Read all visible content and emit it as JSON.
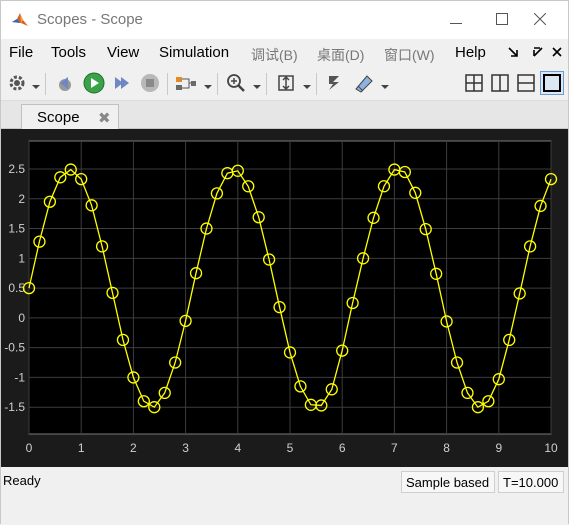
{
  "window": {
    "title": "Scopes - Scope",
    "minimize_icon": "minimize-icon",
    "maximize_icon": "maximize-icon",
    "close_icon": "close-icon"
  },
  "menu": {
    "items": [
      "File",
      "Tools",
      "View",
      "Simulation",
      "调试(B)",
      "桌面(D)",
      "窗口(W)",
      "Help"
    ]
  },
  "toolbar": {
    "icons": [
      "gear-icon",
      "step-back-icon",
      "run-icon",
      "step-forward-icon",
      "stop-icon",
      "signal-selector-icon",
      "zoom-in-icon",
      "fit-to-view-icon",
      "cursor-measurement-icon",
      "highlight-icon",
      "layout-2x2-icon",
      "layout-columns-icon",
      "layout-rows-icon",
      "layout-single-icon"
    ]
  },
  "tab": {
    "label": "Scope",
    "close": "✖"
  },
  "status": {
    "text": "Ready",
    "sample_mode": "Sample based",
    "time": "T=10.000"
  },
  "chart_data": {
    "type": "line",
    "title": "",
    "xlabel": "",
    "ylabel": "",
    "xlim": [
      0,
      10
    ],
    "ylim": [
      -1.95,
      2.97
    ],
    "xticks": [
      "0",
      "1",
      "2",
      "3",
      "4",
      "5",
      "6",
      "7",
      "8",
      "9",
      "10"
    ],
    "yticks": [
      "-1.5",
      "-1",
      "-0.5",
      "0",
      "0.5",
      "1",
      "1.5",
      "2",
      "2.5"
    ],
    "grid": true,
    "line_color": "#ffff00",
    "background": "#000000",
    "series": [
      {
        "marker": "circle",
        "x": [
          0,
          0.2,
          0.4,
          0.6,
          0.8,
          1.0,
          1.2,
          1.4,
          1.6,
          1.8,
          2.0,
          2.2,
          2.4,
          2.6,
          2.8,
          3.0,
          3.2,
          3.4,
          3.6,
          3.8,
          4.0,
          4.2,
          4.4,
          4.6,
          4.8,
          5.0,
          5.2,
          5.4,
          5.6,
          5.8,
          6.0,
          6.2,
          6.4,
          6.6,
          6.8,
          7.0,
          7.2,
          7.4,
          7.6,
          7.8,
          8.0,
          8.2,
          8.4,
          8.6,
          8.8,
          9.0,
          9.2,
          9.4,
          9.6,
          9.8,
          10.0
        ],
        "y": [
          0.5,
          1.28,
          1.95,
          2.36,
          2.49,
          2.33,
          1.89,
          1.2,
          0.42,
          -0.37,
          -1.0,
          -1.4,
          -1.5,
          -1.26,
          -0.75,
          -0.05,
          0.75,
          1.5,
          2.09,
          2.43,
          2.47,
          2.21,
          1.69,
          0.98,
          0.18,
          -0.58,
          -1.15,
          -1.46,
          -1.47,
          -1.2,
          -0.55,
          0.25,
          1.0,
          1.68,
          2.21,
          2.49,
          2.45,
          2.1,
          1.49,
          0.74,
          -0.06,
          -0.75,
          -1.26,
          -1.5,
          -1.4,
          -1.03,
          -0.37,
          0.41,
          1.2,
          1.88,
          2.33
        ]
      }
    ]
  }
}
